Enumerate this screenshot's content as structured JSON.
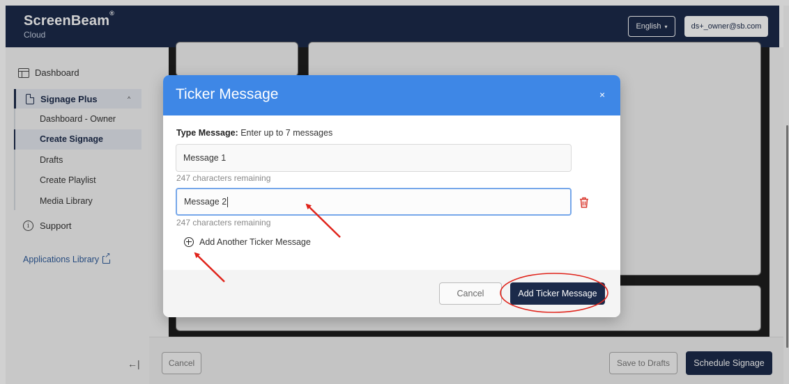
{
  "header": {
    "brand": "ScreenBeam",
    "brand_mark": "®",
    "brand_sub": "Cloud",
    "language": "English",
    "language_caret": "▾",
    "user": "ds+_owner@sb.com"
  },
  "sidebar": {
    "dashboard": "Dashboard",
    "group_label": "Signage Plus",
    "group_chevron": "^",
    "items": [
      {
        "label": "Dashboard - Owner"
      },
      {
        "label": "Create Signage"
      },
      {
        "label": "Drafts"
      },
      {
        "label": "Create Playlist"
      },
      {
        "label": "Media Library"
      }
    ],
    "support": "Support",
    "support_icon_glyph": "i",
    "apps_library": "Applications Library",
    "collapse_glyph": "←|"
  },
  "bottom_bar": {
    "cancel": "Cancel",
    "save_drafts": "Save to Drafts",
    "schedule": "Schedule Signage"
  },
  "modal": {
    "title": "Ticker Message",
    "close_glyph": "×",
    "type_label": "Type Message:",
    "type_hint": "Enter up to 7 messages",
    "messages": [
      {
        "value": "Message 1",
        "remaining": "247 characters remaining"
      },
      {
        "value": "Message 2",
        "remaining": "247 characters remaining"
      }
    ],
    "add_another": "Add Another Ticker Message",
    "cancel": "Cancel",
    "submit": "Add Ticker Message"
  },
  "colors": {
    "header_bg": "#1b2a4a",
    "modal_header": "#3e87e6",
    "primary_button": "#1b2a4a",
    "trash": "#d9362b",
    "annotation": "#e0231a"
  },
  "icons": [
    "layout-icon",
    "document-icon",
    "info-icon",
    "external-link-icon",
    "collapse-icon",
    "close-icon",
    "trash-icon",
    "plus-circle-icon"
  ]
}
